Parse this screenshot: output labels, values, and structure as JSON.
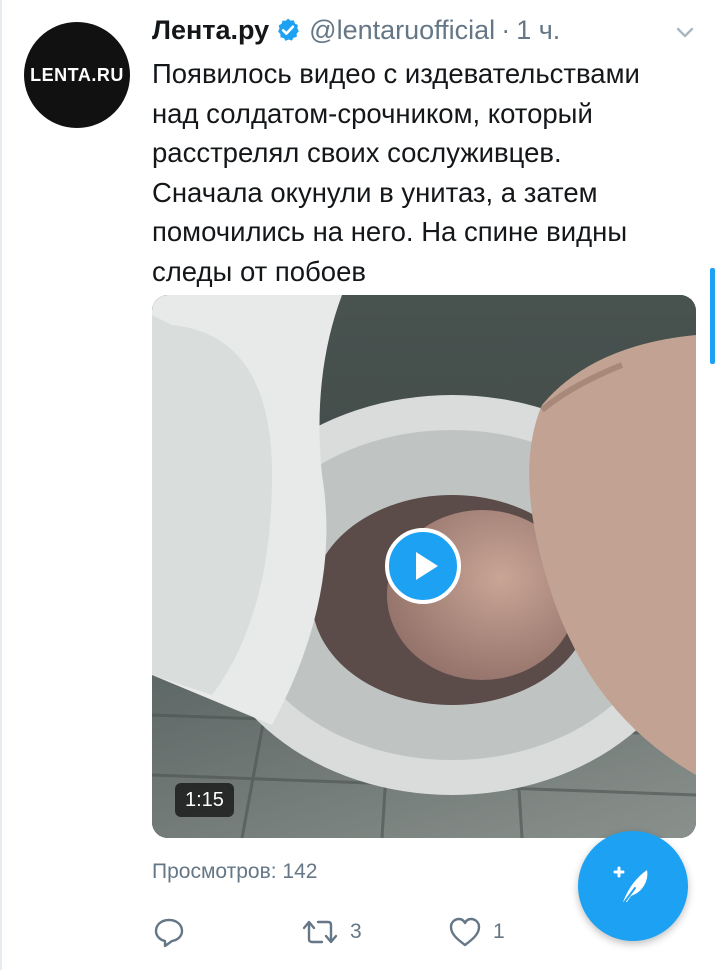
{
  "tweet": {
    "display_name": "Лента.ру",
    "handle": "@lentaruofficial",
    "separator": "·",
    "time": "1 ч.",
    "avatar_text": "LENTA.RU",
    "text_lines": [
      "Появилось видео с издевательствами",
      "над солдатом-срочником, который",
      "расстрелял своих сослуживцев.",
      "Сначала окунули в унитаз, а затем",
      "помочились на него. На спине видны",
      "следы от побоев"
    ],
    "video": {
      "duration": "1:15"
    },
    "views": "Просмотров: 142",
    "actions": {
      "reply_count": "",
      "retweet_count": "3",
      "like_count": "1"
    }
  },
  "colors": {
    "accent": "#1da1f2",
    "secondary_text": "#657786",
    "primary_text": "#14171a"
  },
  "icons": {
    "verified": "verified-badge-icon",
    "menu": "chevron-down-icon",
    "play": "play-icon",
    "reply": "reply-icon",
    "retweet": "retweet-icon",
    "like": "heart-icon",
    "compose": "compose-feather-icon"
  }
}
